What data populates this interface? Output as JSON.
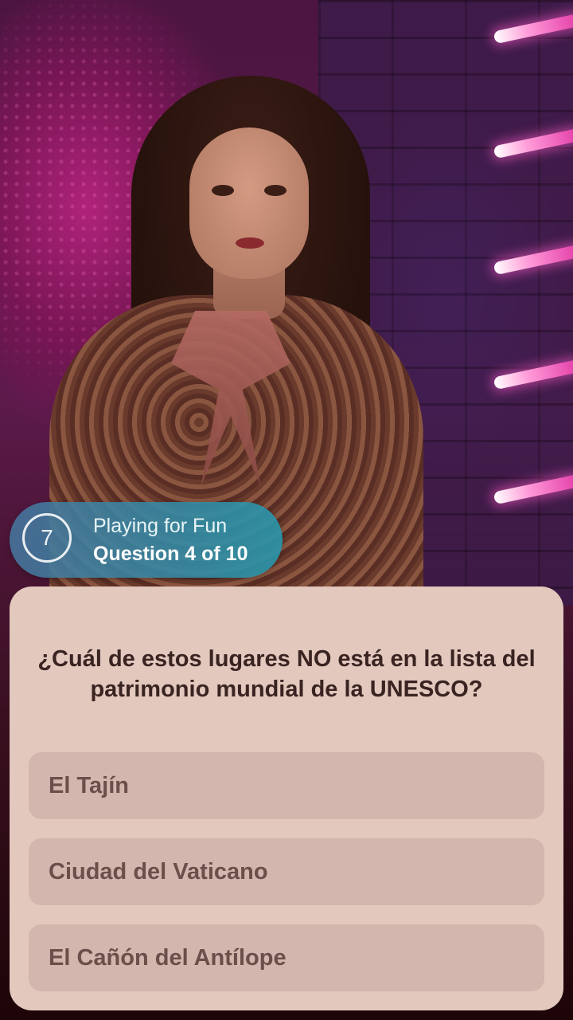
{
  "status": {
    "timer_value": "7",
    "mode_label": "Playing for Fun",
    "progress_label": "Question 4 of 10"
  },
  "question": {
    "text": "¿Cuál de estos lugares NO está en la lista del patrimonio mundial de la UNESCO?"
  },
  "answers": [
    {
      "label": "El Tajín"
    },
    {
      "label": "Ciudad del Vaticano"
    },
    {
      "label": "El Cañón del Antílope"
    }
  ],
  "colors": {
    "card_background": "#e2c8bd",
    "answer_background": "#d3b6ad",
    "answer_text": "#6a4f4b",
    "question_text": "#3a2422",
    "pill_start": "#4678a0",
    "pill_end": "#2896aa"
  }
}
